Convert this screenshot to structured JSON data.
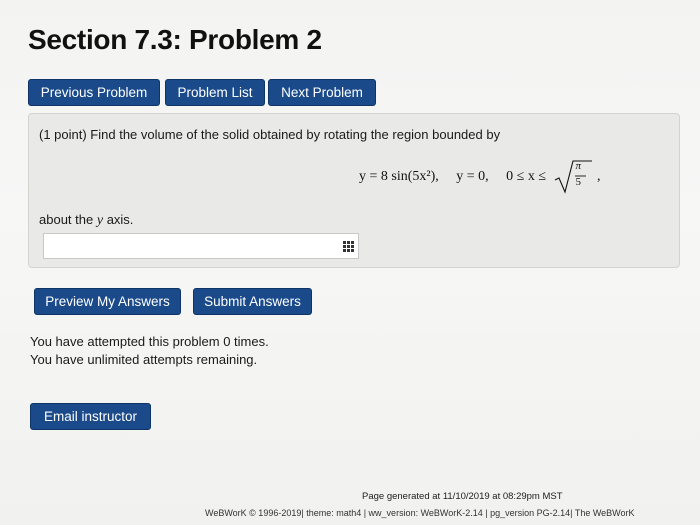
{
  "header": {
    "title": "Section 7.3: Problem 2"
  },
  "nav": {
    "previous_label": "Previous Problem",
    "list_label": "Problem List",
    "next_label": "Next Problem"
  },
  "problem": {
    "statement": "(1 point) Find the volume of the solid obtained by rotating the region bounded by",
    "eq1": "y = 8 sin(5x²),",
    "eq2": "y = 0,",
    "eq3": "0 ≤ x ≤",
    "sqrt_numerator": "π",
    "sqrt_denominator": "5",
    "eq_end": ",",
    "about_prefix": "about the",
    "about_var": "y",
    "about_suffix": "axis.",
    "answer_value": "",
    "answer_placeholder": ""
  },
  "actions": {
    "preview_label": "Preview My Answers",
    "submit_label": "Submit Answers"
  },
  "attempts": {
    "line1": "You have attempted this problem 0 times.",
    "line2": "You have unlimited attempts remaining."
  },
  "email": {
    "label": "Email instructor"
  },
  "footer": {
    "generated": "Page generated at 11/10/2019 at 08:29pm MST",
    "credits": "WeBWorK © 1996-2019| theme: math4 | ww_version: WeBWorK-2.14 | pg_version PG-2.14| The WeBWorK"
  },
  "colors": {
    "button_bg": "#1a4a8a",
    "button_text": "#ffffff",
    "problem_box_bg": "#e9e9e7"
  },
  "icons": {
    "math_palette": "grid-icon"
  }
}
